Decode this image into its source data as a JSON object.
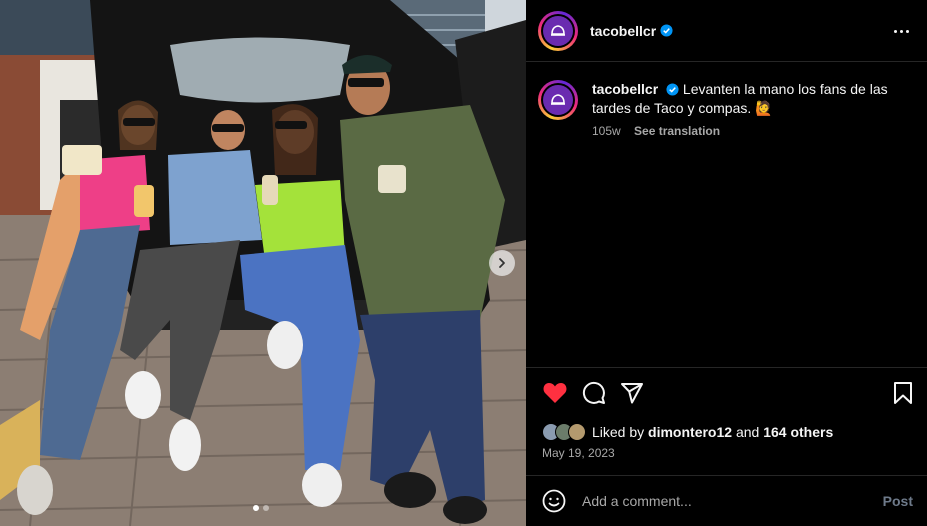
{
  "post": {
    "username": "tacobellcr",
    "caption": "Levanten la mano los fans de las tardes de Taco y compas.",
    "caption_emoji": "🙋",
    "age": "105w",
    "see_translation": "See translation",
    "liked_by_prefix": "Liked by",
    "liked_by_user": "dimontero12",
    "liked_by_and": "and",
    "liked_by_others": "164 others",
    "date": "May 19, 2023",
    "comment_placeholder": "Add a comment...",
    "post_label": "Post",
    "carousel": {
      "slides": 2,
      "active": 1
    }
  },
  "colors": {
    "brand_purple": "#6a2bb0",
    "like_red": "#ff3040",
    "verified_blue": "#0095f6",
    "muted_text": "#a8a8a8",
    "border": "#262626"
  },
  "icons": [
    "verified-icon",
    "more-icon",
    "heart-icon",
    "comment-icon",
    "share-icon",
    "bookmark-icon",
    "emoji-icon",
    "chevron-right-icon"
  ]
}
